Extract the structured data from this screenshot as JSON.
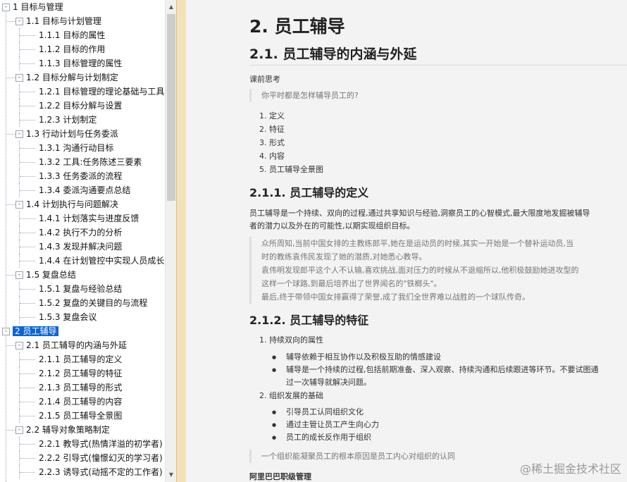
{
  "tree": {
    "items": [
      {
        "label": "1 目标与管理",
        "level": 0,
        "toggle": "-"
      },
      {
        "label": "1.1 目标与计划管理",
        "level": 1,
        "toggle": "-"
      },
      {
        "label": "1.1.1 目标的属性",
        "level": 2
      },
      {
        "label": "1.1.2 目标的作用",
        "level": 2
      },
      {
        "label": "1.1.3 目标管理的属性",
        "level": 2
      },
      {
        "label": "1.2 目标分解与计划制定",
        "level": 1,
        "toggle": "-"
      },
      {
        "label": "1.2.1 目标管理的理论基础与工具",
        "level": 2
      },
      {
        "label": "1.2.2 目标分解与设置",
        "level": 2
      },
      {
        "label": "1.2.3 计划制定",
        "level": 2
      },
      {
        "label": "1.3 行动计划与任务委派",
        "level": 1,
        "toggle": "-"
      },
      {
        "label": "1.3.1 沟通行动目标",
        "level": 2
      },
      {
        "label": "1.3.2 工具:任务陈述三要素",
        "level": 2
      },
      {
        "label": "1.3.3 任务委派的流程",
        "level": 2
      },
      {
        "label": "1.3.4 委派沟通要点总结",
        "level": 2
      },
      {
        "label": "1.4 计划执行与问题解决",
        "level": 1,
        "toggle": "-"
      },
      {
        "label": "1.4.1 计划落实与进度反馈",
        "level": 2
      },
      {
        "label": "1.4.2 执行不力的分析",
        "level": 2
      },
      {
        "label": "1.4.3 发现并解决问题",
        "level": 2
      },
      {
        "label": "1.4.4 在计划管控中实现人员成长",
        "level": 2
      },
      {
        "label": "1.5 复盘总结",
        "level": 1,
        "toggle": "-"
      },
      {
        "label": "1.5.1 复盘与经验总结",
        "level": 2
      },
      {
        "label": "1.5.2 复盘的关键目的与流程",
        "level": 2
      },
      {
        "label": "1.5.3 复盘会议",
        "level": 2
      },
      {
        "label": "2 员工辅导",
        "level": 0,
        "toggle": "-",
        "selected": true
      },
      {
        "label": "2.1 员工辅导的内涵与外延",
        "level": 1,
        "toggle": "-"
      },
      {
        "label": "2.1.1 员工辅导的定义",
        "level": 2
      },
      {
        "label": "2.1.2 员工辅导的特征",
        "level": 2
      },
      {
        "label": "2.1.3 员工辅导的形式",
        "level": 2
      },
      {
        "label": "2.1.4 员工辅导的内容",
        "level": 2
      },
      {
        "label": "2.1.5 员工辅导全景图",
        "level": 2
      },
      {
        "label": "2.2 辅导对象策略制定",
        "level": 1,
        "toggle": "-"
      },
      {
        "label": "2.2.1 教导式(热情洋溢的初学者)",
        "level": 2
      },
      {
        "label": "2.2.2 引导式(憧憬幻灭的学习者)",
        "level": 2
      },
      {
        "label": "2.2.3 诱导式(动摇不定的工作者)",
        "level": 2
      }
    ]
  },
  "doc": {
    "h1": "2. 员工辅导",
    "h2": "2.1. 员工辅导的内涵与外延",
    "pre_label": "课前思考",
    "question": "你平时都是怎样辅导员工的?",
    "outline": [
      "定义",
      "特征",
      "形式",
      "内容",
      "员工辅导全景图"
    ],
    "h3_def": "2.1.1. 员工辅导的定义",
    "def_text": [
      "员工辅导是一个持续、双向的过程,通过共享知识与经验,洞察员工的心智模式,最大限度地发掘被辅导",
      "者的潜力以及外在的可能性,以期实现组织目标。"
    ],
    "story": [
      "众所周知,当前中国女排的主教练郎平,她在是运动员的时候,其实一开始是一个替补运动员,当",
      "时的教练袁伟民发现了她的潜质,对她悉心教导。",
      "袁伟明发现郎平这个人不认输,喜欢挑战,面对压力的时候从不退缩所以,他积极鼓励她进攻型的",
      "这样一个球路,到最后培养出了世界闻名的\"铁榔头\"。",
      "最后,终于带领中国女排赢得了荣誉,成了我们全世界难以战胜的一个球队传奇。"
    ],
    "h3_feat": "2.1.2. 员工辅导的特征",
    "feat1_title": "持续双向的属性",
    "feat1_items": [
      "辅导依赖于相互协作以及积极互助的情感建设",
      "辅导是一个持续的过程,包括前期准备、深入观察、持续沟通和后续跟进等环节。不要试图通",
      "过一次辅导就解决问题。"
    ],
    "feat2_title": "组织发展的基础",
    "feat2_items": [
      "引导员工认同组织文化",
      "通过主管让员工产生向心力",
      "员工的成长反作用于组织"
    ],
    "quote2": "一个组织能凝聚员工的根本原因是员工内心对组织的认同",
    "bold_label": "阿里巴巴职级管理"
  },
  "watermark": "@稀土掘金技术社区"
}
